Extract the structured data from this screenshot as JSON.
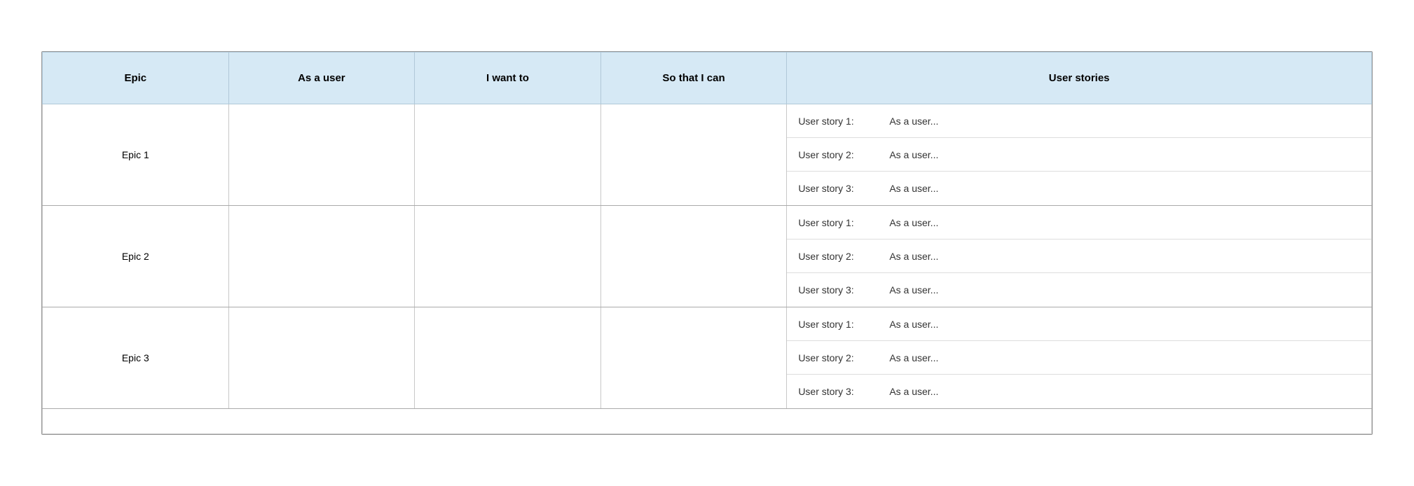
{
  "table": {
    "headers": {
      "epic": "Epic",
      "as_a_user": "As a user",
      "i_want_to": "I want to",
      "so_that": "So that I can",
      "user_stories": "User stories"
    },
    "rows": [
      {
        "epic": "Epic 1",
        "stories": [
          {
            "label": "User story 1:",
            "value": "As a user..."
          },
          {
            "label": "User story 2:",
            "value": "As a user..."
          },
          {
            "label": "User story 3:",
            "value": "As a user..."
          }
        ]
      },
      {
        "epic": "Epic 2",
        "stories": [
          {
            "label": "User story 1:",
            "value": "As a user..."
          },
          {
            "label": "User story 2:",
            "value": "As a user..."
          },
          {
            "label": "User story 3:",
            "value": "As a user..."
          }
        ]
      },
      {
        "epic": "Epic 3",
        "stories": [
          {
            "label": "User story 1:",
            "value": "As a user..."
          },
          {
            "label": "User story 2:",
            "value": "As a user..."
          },
          {
            "label": "User story 3:",
            "value": "As a user..."
          }
        ]
      }
    ]
  }
}
